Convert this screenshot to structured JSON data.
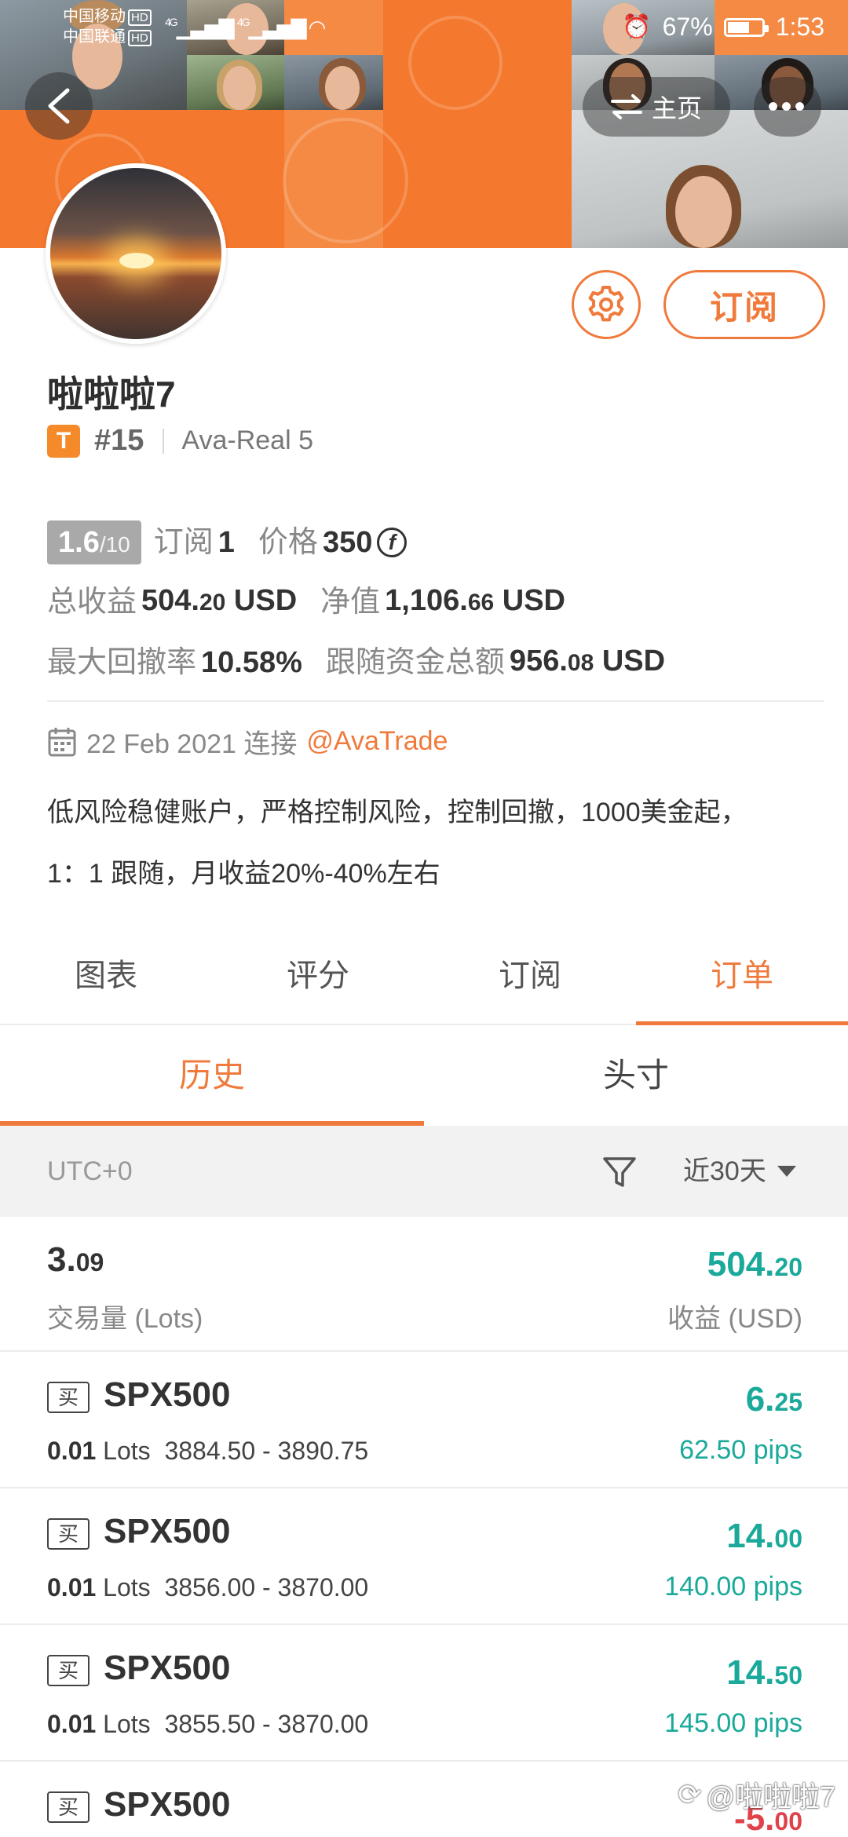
{
  "status_bar": {
    "carrier1": "中国移动",
    "carrier2": "中国联通",
    "hd": "HD",
    "signal": "4G",
    "battery": "67%",
    "battery_level": 0.67,
    "time": "1:53"
  },
  "header": {
    "home_label": "主页",
    "more_label": "•••",
    "subscribe_label": "订阅"
  },
  "profile": {
    "name": "啦啦啦7",
    "badge": "T",
    "rank": "#15",
    "server": "Ava-Real 5",
    "score_main": "1.6",
    "score_total": "/10",
    "subs_label": "订阅",
    "subs_value": "1",
    "price_label": "价格",
    "price_value": "350",
    "coin_symbol": "f",
    "profit_label": "总收益",
    "profit_int": "504.",
    "profit_dec": "20",
    "profit_unit": "USD",
    "equity_label": "净值",
    "equity_int": "1,106.",
    "equity_dec": "66",
    "equity_unit": "USD",
    "drawdown_label": "最大回撤率",
    "drawdown_value": "10.58%",
    "follow_label": "跟随资金总额",
    "follow_int": "956.",
    "follow_dec": "08",
    "follow_unit": "USD",
    "date": "22 Feb 2021 连接",
    "broker": "@AvaTrade",
    "desc1": "低风险稳健账户，严格控制风险，控制回撤，1000美金起，",
    "desc2": "1：1 跟随，月收益20%-40%左右"
  },
  "tabs": [
    "图表",
    "评分",
    "订阅",
    "订单"
  ],
  "subtabs": [
    "历史",
    "头寸"
  ],
  "filter": {
    "timezone": "UTC+0",
    "range": "近30天"
  },
  "summary": {
    "vol_int": "3.",
    "vol_dec": "09",
    "vol_label": "交易量 (Lots)",
    "pnl_int": "504.",
    "pnl_dec": "20",
    "pnl_label": "收益 (USD)"
  },
  "orders": [
    {
      "side": "买",
      "symbol": "SPX500",
      "lots": "0.01",
      "lots_unit": "Lots",
      "range": "3884.50 - 3890.75",
      "profit_int": "6.",
      "profit_dec": "25",
      "pips": "62.50 pips"
    },
    {
      "side": "买",
      "symbol": "SPX500",
      "lots": "0.01",
      "lots_unit": "Lots",
      "range": "3856.00 - 3870.00",
      "profit_int": "14.",
      "profit_dec": "00",
      "pips": "140.00 pips"
    },
    {
      "side": "买",
      "symbol": "SPX500",
      "lots": "0.01",
      "lots_unit": "Lots",
      "range": "3855.50 - 3870.00",
      "profit_int": "14.",
      "profit_dec": "50",
      "pips": "145.00 pips"
    },
    {
      "side": "买",
      "symbol": "SPX500",
      "profit_int": "-5.",
      "profit_dec": "00"
    }
  ],
  "watermark": "@啦啦啦7",
  "colors": {
    "accent": "#f07a3c",
    "positive": "#1aa99a",
    "negative": "#e0424a"
  }
}
